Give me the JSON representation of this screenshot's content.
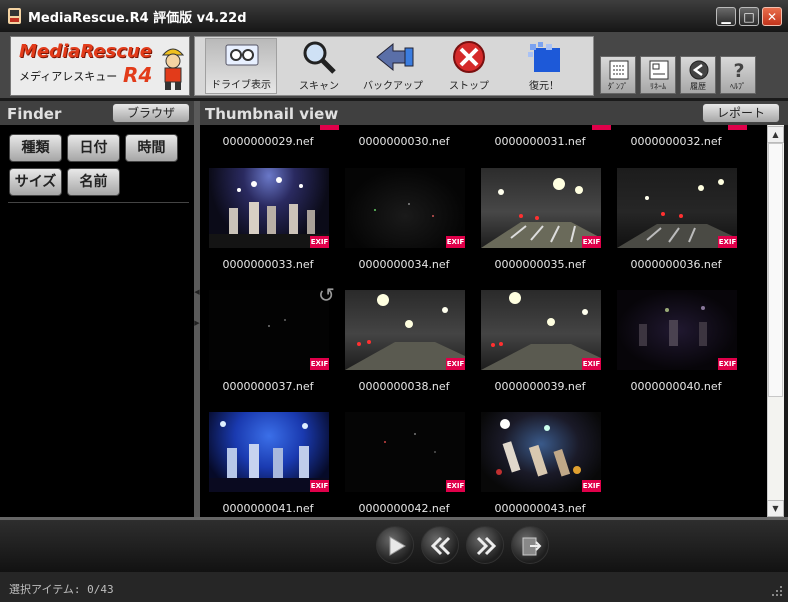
{
  "window": {
    "title": "MediaRescue.R4 評価版 v4.22d",
    "controls": [
      "minimize",
      "maximize",
      "close"
    ]
  },
  "logo": {
    "line1": "MediaRescue",
    "line2": "メディアレスキュー",
    "line3": "R4"
  },
  "toolbar": {
    "buttons": [
      {
        "label": "ドライブ表示",
        "icon": "drive-icon",
        "active": true
      },
      {
        "label": "スキャン",
        "icon": "magnifier-icon"
      },
      {
        "label": "バックアップ",
        "icon": "backup-arrow-icon"
      },
      {
        "label": "ストップ",
        "icon": "stop-icon"
      },
      {
        "label": "復元！",
        "icon": "restore-icon"
      }
    ],
    "tools": [
      {
        "label": "ﾀﾞﾝﾌﾟ",
        "icon": "dump-icon"
      },
      {
        "label": "ﾘﾈｰﾑ",
        "icon": "rename-icon"
      },
      {
        "label": "履歴",
        "icon": "history-icon"
      },
      {
        "label": "ﾍﾙﾌﾟ",
        "icon": "help-icon"
      }
    ]
  },
  "finder": {
    "title": "Finder",
    "browser_button": "ブラウザ",
    "filters": [
      "種類",
      "日付",
      "時間",
      "サイズ",
      "名前"
    ]
  },
  "thumbnail_view": {
    "title": "Thumbnail view",
    "report_button": "レポート",
    "exif_badge": "EXIF",
    "top_captions": [
      "0000000029.nef",
      "0000000030.nef",
      "0000000031.nef",
      "0000000032.nef"
    ],
    "items": [
      {
        "name": "0000000033.nef",
        "scene": "concert"
      },
      {
        "name": "0000000034.nef",
        "scene": "dark"
      },
      {
        "name": "0000000035.nef",
        "scene": "road"
      },
      {
        "name": "0000000036.nef",
        "scene": "road-dark"
      },
      {
        "name": "0000000037.nef",
        "scene": "dark"
      },
      {
        "name": "0000000038.nef",
        "scene": "road"
      },
      {
        "name": "0000000039.nef",
        "scene": "road"
      },
      {
        "name": "0000000040.nef",
        "scene": "concert-dark"
      },
      {
        "name": "0000000041.nef",
        "scene": "concert-blue"
      },
      {
        "name": "0000000042.nef",
        "scene": "dark"
      },
      {
        "name": "0000000043.nef",
        "scene": "concert-tilt"
      }
    ]
  },
  "navigation": {
    "buttons": [
      "play",
      "previous",
      "next",
      "export"
    ]
  },
  "status": {
    "text": "選択アイテム: 0/43"
  },
  "colors": {
    "exif": "#e0004a",
    "logo_red": "#e23b1a",
    "background": "#000000"
  }
}
